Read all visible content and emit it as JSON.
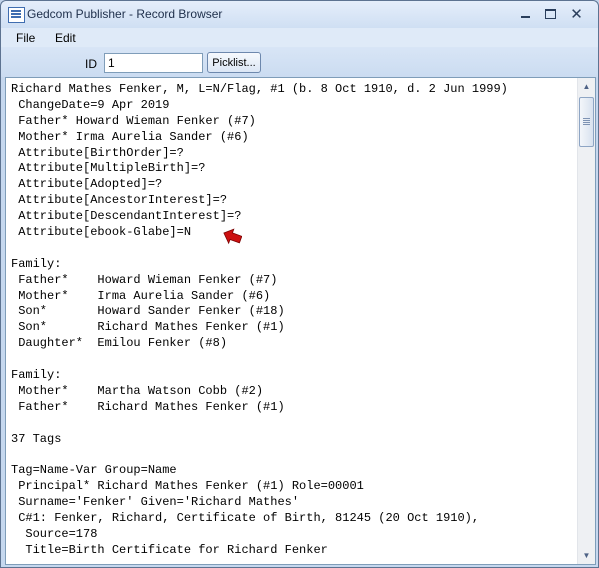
{
  "window": {
    "title": "Gedcom Publisher - Record Browser"
  },
  "menu": {
    "file": "File",
    "edit": "Edit"
  },
  "toolbar": {
    "id_label": "ID",
    "id_value": "1",
    "picklist_label": "Picklist..."
  },
  "icons": {
    "annotation_arrow": "red-pointer-arrow",
    "arrow_color": "#cc1111"
  },
  "record_lines": [
    "Richard Mathes Fenker, M, L=N/Flag, #1 (b. 8 Oct 1910, d. 2 Jun 1999)",
    " ChangeDate=9 Apr 2019",
    " Father* Howard Wieman Fenker (#7)",
    " Mother* Irma Aurelia Sander (#6)",
    " Attribute[BirthOrder]=?",
    " Attribute[MultipleBirth]=?",
    " Attribute[Adopted]=?",
    " Attribute[AncestorInterest]=?",
    " Attribute[DescendantInterest]=?",
    " Attribute[ebook-Glabe]=N",
    "",
    "Family:",
    " Father*    Howard Wieman Fenker (#7)",
    " Mother*    Irma Aurelia Sander (#6)",
    " Son*       Howard Sander Fenker (#18)",
    " Son*       Richard Mathes Fenker (#1)",
    " Daughter*  Emilou Fenker (#8)",
    "",
    "Family:",
    " Mother*    Martha Watson Cobb (#2)",
    " Father*    Richard Mathes Fenker (#1)",
    "",
    "37 Tags",
    "",
    "Tag=Name-Var Group=Name",
    " Principal* Richard Mathes Fenker (#1) Role=00001",
    " Surname='Fenker' Given='Richard Mathes'",
    " C#1: Fenker, Richard, Certificate of Birth, 81245 (20 Oct 1910),",
    "  Source=178",
    "  Title=Birth Certificate for Richard Fenker"
  ]
}
